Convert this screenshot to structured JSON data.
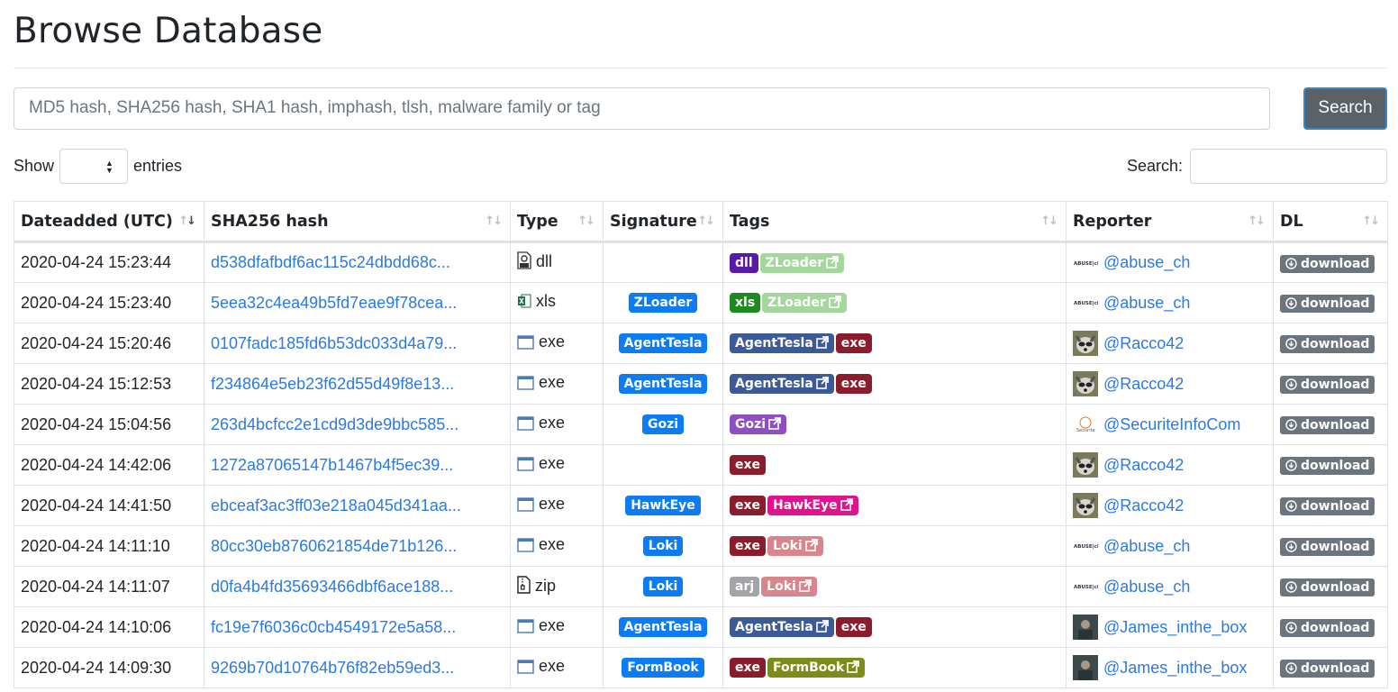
{
  "page": {
    "title": "Browse Database"
  },
  "search": {
    "placeholder": "MD5 hash, SHA256 hash, SHA1 hash, imphash, tlsh, malware family or tag",
    "button_label": "Search"
  },
  "table_controls": {
    "show_label": "Show",
    "entries_label": "entries",
    "search_label": "Search:"
  },
  "columns": [
    "Dateadded (UTC)",
    "SHA256 hash",
    "Type",
    "Signature",
    "Tags",
    "Reporter",
    "DL"
  ],
  "download_label": "download",
  "colors": {
    "ZLoader": "#a3d79b",
    "AgentTesla": "#3d5a98",
    "Gozi": "#8e4fc5",
    "HawkEye": "#e0138c",
    "Loki": "#d9858b",
    "FormBook": "#7d8b1a",
    "dll": "#5a1aa8",
    "xls": "#1d8a1d",
    "exe": "#8b1c2c",
    "arj": "#a3a3a8",
    "signature": "#0d7cf2"
  },
  "rows": [
    {
      "date": "2020-04-24 15:23:44",
      "hash": "d538dfafbdf6ac115c24dbdd68c...",
      "type": "dll",
      "type_icon": "dll-file-icon",
      "signature": "",
      "tags": [
        {
          "label": "dll",
          "color": "#5a1aa8",
          "link": false
        },
        {
          "label": "ZLoader",
          "color": "#a3d79b",
          "link": true
        }
      ],
      "reporter": "@abuse_ch",
      "avatar": "abuse"
    },
    {
      "date": "2020-04-24 15:23:40",
      "hash": "5eea32c4ea49b5fd7eae9f78cea...",
      "type": "xls",
      "type_icon": "excel-file-icon",
      "signature": "ZLoader",
      "tags": [
        {
          "label": "xls",
          "color": "#1d8a1d",
          "link": false
        },
        {
          "label": "ZLoader",
          "color": "#a3d79b",
          "link": true
        }
      ],
      "reporter": "@abuse_ch",
      "avatar": "abuse"
    },
    {
      "date": "2020-04-24 15:20:46",
      "hash": "0107fadc185fd6b53dc033d4a79...",
      "type": "exe",
      "type_icon": "window-icon",
      "signature": "AgentTesla",
      "tags": [
        {
          "label": "AgentTesla",
          "color": "#3d5a98",
          "link": true
        },
        {
          "label": "exe",
          "color": "#8b1c2c",
          "link": false
        }
      ],
      "reporter": "@Racco42",
      "avatar": "raccoon"
    },
    {
      "date": "2020-04-24 15:12:53",
      "hash": "f234864e5eb23f62d55d49f8e13...",
      "type": "exe",
      "type_icon": "window-icon",
      "signature": "AgentTesla",
      "tags": [
        {
          "label": "AgentTesla",
          "color": "#3d5a98",
          "link": true
        },
        {
          "label": "exe",
          "color": "#8b1c2c",
          "link": false
        }
      ],
      "reporter": "@Racco42",
      "avatar": "raccoon"
    },
    {
      "date": "2020-04-24 15:04:56",
      "hash": "263d4bcfcc2e1cd9d3de9bbc585...",
      "type": "exe",
      "type_icon": "window-icon",
      "signature": "Gozi",
      "tags": [
        {
          "label": "Gozi",
          "color": "#8e4fc5",
          "link": true
        }
      ],
      "reporter": "@SecuriteInfoCom",
      "avatar": "securite"
    },
    {
      "date": "2020-04-24 14:42:06",
      "hash": "1272a87065147b1467b4f5ec39...",
      "type": "exe",
      "type_icon": "window-icon",
      "signature": "",
      "tags": [
        {
          "label": "exe",
          "color": "#8b1c2c",
          "link": false
        }
      ],
      "reporter": "@Racco42",
      "avatar": "raccoon"
    },
    {
      "date": "2020-04-24 14:41:50",
      "hash": "ebceaf3ac3ff03e218a045d341aa...",
      "type": "exe",
      "type_icon": "window-icon",
      "signature": "HawkEye",
      "tags": [
        {
          "label": "exe",
          "color": "#8b1c2c",
          "link": false
        },
        {
          "label": "HawkEye",
          "color": "#e0138c",
          "link": true
        }
      ],
      "reporter": "@Racco42",
      "avatar": "raccoon"
    },
    {
      "date": "2020-04-24 14:11:10",
      "hash": "80cc30eb8760621854de71b126...",
      "type": "exe",
      "type_icon": "window-icon",
      "signature": "Loki",
      "tags": [
        {
          "label": "exe",
          "color": "#8b1c2c",
          "link": false
        },
        {
          "label": "Loki",
          "color": "#d9858b",
          "link": true
        }
      ],
      "reporter": "@abuse_ch",
      "avatar": "abuse"
    },
    {
      "date": "2020-04-24 14:11:07",
      "hash": "d0fa4b4fd35693466dbf6ace188...",
      "type": "zip",
      "type_icon": "zip-file-icon",
      "signature": "Loki",
      "tags": [
        {
          "label": "arj",
          "color": "#a3a3a8",
          "link": false
        },
        {
          "label": "Loki",
          "color": "#d9858b",
          "link": true
        }
      ],
      "reporter": "@abuse_ch",
      "avatar": "abuse"
    },
    {
      "date": "2020-04-24 14:10:06",
      "hash": "fc19e7f6036c0cb4549172e5a58...",
      "type": "exe",
      "type_icon": "window-icon",
      "signature": "AgentTesla",
      "tags": [
        {
          "label": "AgentTesla",
          "color": "#3d5a98",
          "link": true
        },
        {
          "label": "exe",
          "color": "#8b1c2c",
          "link": false
        }
      ],
      "reporter": "@James_inthe_box",
      "avatar": "james"
    },
    {
      "date": "2020-04-24 14:09:30",
      "hash": "9269b70d10764b76f82eb59ed3...",
      "type": "exe",
      "type_icon": "window-icon",
      "signature": "FormBook",
      "tags": [
        {
          "label": "exe",
          "color": "#8b1c2c",
          "link": false
        },
        {
          "label": "FormBook",
          "color": "#7d8b1a",
          "link": true
        }
      ],
      "reporter": "@James_inthe_box",
      "avatar": "james"
    }
  ]
}
